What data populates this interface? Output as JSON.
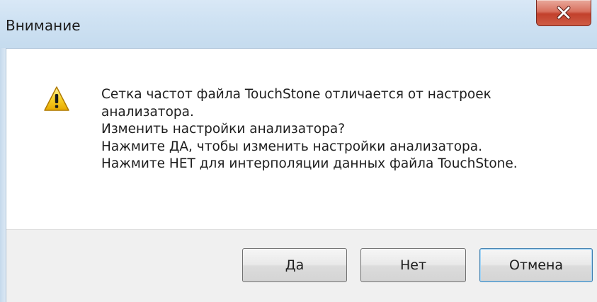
{
  "window": {
    "title": "Внимание"
  },
  "icons": {
    "close": "close-icon",
    "warning": "warning-icon"
  },
  "message": {
    "lines": [
      "Сетка частот файла TouchStone отличается от настроек",
      "анализатора.",
      "Изменить настройки анализатора?",
      "Нажмите ДА, чтобы изменить настройки анализатора.",
      "Нажмите НЕТ для интерполяции данных файла TouchStone."
    ]
  },
  "buttons": {
    "yes": "Да",
    "no": "Нет",
    "cancel": "Отмена"
  },
  "colors": {
    "title_bar": "#cfe2f3",
    "close_button": "#c2402c",
    "button_area": "#f0f0f0",
    "warning": "#f5c400"
  }
}
